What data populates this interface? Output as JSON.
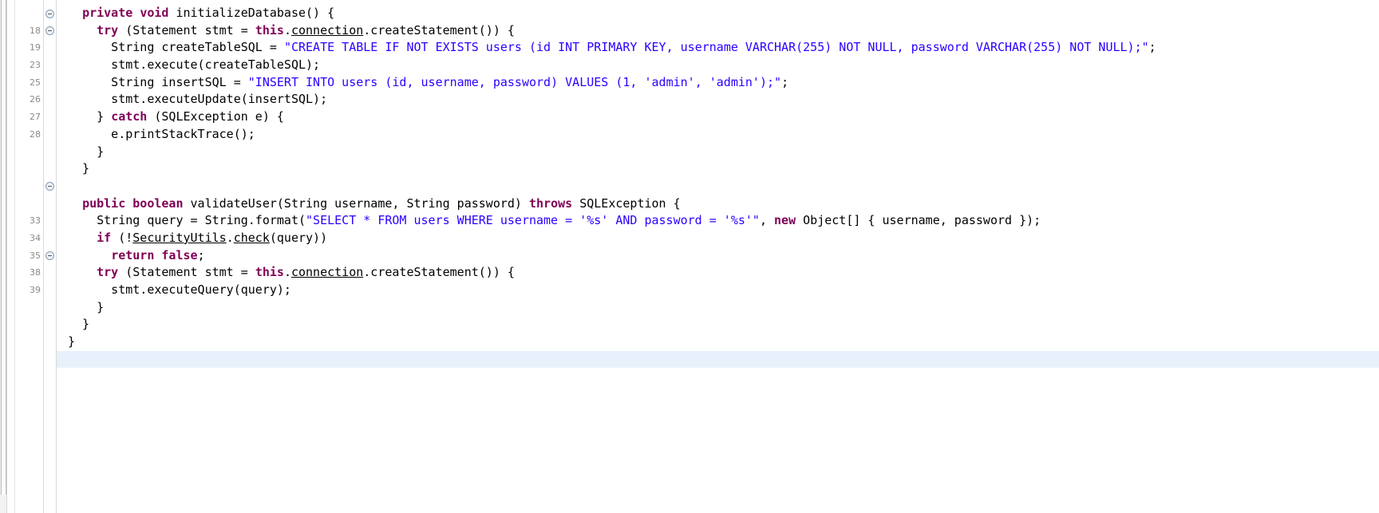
{
  "editor": {
    "language": "java",
    "colors": {
      "keyword": "#7f0055",
      "string": "#2a00ff",
      "field": "#0000c0",
      "text": "#000000",
      "gutter_text": "#8a8a8a",
      "current_line_highlight": "#e8f1fb",
      "background": "#ffffff"
    },
    "gutter": {
      "line_numbers": [
        "",
        "18",
        "19",
        "23",
        "25",
        "26",
        "27",
        "28",
        "",
        "",
        "",
        "33",
        "34",
        "35",
        "38",
        "39",
        "",
        "",
        "",
        "",
        ""
      ]
    },
    "fold_markers": [
      {
        "row": 0,
        "state": "collapsible"
      },
      {
        "row": 1,
        "state": "collapsible"
      },
      {
        "row": 10,
        "state": "collapsible"
      },
      {
        "row": 14,
        "state": "collapsible"
      }
    ],
    "lines": [
      {
        "index": 0,
        "number": "",
        "highlight": false,
        "tokens": [
          {
            "t": "  ",
            "k": "plain"
          },
          {
            "t": "private",
            "k": "kw"
          },
          {
            "t": " ",
            "k": "plain"
          },
          {
            "t": "void",
            "k": "kw"
          },
          {
            "t": " initializeDatabase() {",
            "k": "plain"
          }
        ]
      },
      {
        "index": 1,
        "number": "18",
        "highlight": false,
        "tokens": [
          {
            "t": "    ",
            "k": "plain"
          },
          {
            "t": "try",
            "k": "kw"
          },
          {
            "t": " (Statement stmt = ",
            "k": "plain"
          },
          {
            "t": "this",
            "k": "kw"
          },
          {
            "t": ".",
            "k": "plain"
          },
          {
            "t": "connection",
            "k": "stc"
          },
          {
            "t": ".createStatement()) {",
            "k": "plain"
          }
        ]
      },
      {
        "index": 2,
        "number": "19",
        "highlight": false,
        "tokens": [
          {
            "t": "      String createTableSQL = ",
            "k": "plain"
          },
          {
            "t": "\"CREATE TABLE IF NOT EXISTS users (id INT PRIMARY KEY, username VARCHAR(255) NOT NULL, password VARCHAR(255) NOT NULL);\"",
            "k": "str"
          },
          {
            "t": ";",
            "k": "plain"
          }
        ]
      },
      {
        "index": 3,
        "number": "23",
        "highlight": false,
        "tokens": [
          {
            "t": "      stmt.execute(createTableSQL);",
            "k": "plain"
          }
        ]
      },
      {
        "index": 4,
        "number": "25",
        "highlight": false,
        "tokens": [
          {
            "t": "      String insertSQL = ",
            "k": "plain"
          },
          {
            "t": "\"INSERT INTO users (id, username, password) VALUES (1, 'admin', 'admin');\"",
            "k": "str"
          },
          {
            "t": ";",
            "k": "plain"
          }
        ]
      },
      {
        "index": 5,
        "number": "26",
        "highlight": false,
        "tokens": [
          {
            "t": "      stmt.executeUpdate(insertSQL);",
            "k": "plain"
          }
        ]
      },
      {
        "index": 6,
        "number": "27",
        "highlight": false,
        "tokens": [
          {
            "t": "    } ",
            "k": "plain"
          },
          {
            "t": "catch",
            "k": "kw"
          },
          {
            "t": " (SQLException e) {",
            "k": "plain"
          }
        ]
      },
      {
        "index": 7,
        "number": "28",
        "highlight": false,
        "tokens": [
          {
            "t": "      e.printStackTrace();",
            "k": "plain"
          }
        ]
      },
      {
        "index": 8,
        "number": "",
        "highlight": false,
        "tokens": [
          {
            "t": "    }",
            "k": "plain"
          }
        ]
      },
      {
        "index": 9,
        "number": "",
        "highlight": false,
        "tokens": [
          {
            "t": "  }",
            "k": "plain"
          }
        ]
      },
      {
        "index": 10,
        "number": "",
        "highlight": false,
        "tokens": [
          {
            "t": "",
            "k": "plain"
          }
        ]
      },
      {
        "index": 11,
        "number": "",
        "highlight": false,
        "tokens": [
          {
            "t": "  ",
            "k": "plain"
          },
          {
            "t": "public",
            "k": "kw"
          },
          {
            "t": " ",
            "k": "plain"
          },
          {
            "t": "boolean",
            "k": "kw"
          },
          {
            "t": " validateUser(String username, String password) ",
            "k": "plain"
          },
          {
            "t": "throws",
            "k": "kw"
          },
          {
            "t": " SQLException {",
            "k": "plain"
          }
        ]
      },
      {
        "index": 12,
        "number": "33",
        "highlight": false,
        "tokens": [
          {
            "t": "    String query = String.format(",
            "k": "plain"
          },
          {
            "t": "\"SELECT * FROM users WHERE username = '%s' AND password = '%s'\"",
            "k": "str"
          },
          {
            "t": ", ",
            "k": "plain"
          },
          {
            "t": "new",
            "k": "kw"
          },
          {
            "t": " Object[] { username, password });",
            "k": "plain"
          }
        ]
      },
      {
        "index": 13,
        "number": "34",
        "highlight": false,
        "tokens": [
          {
            "t": "    ",
            "k": "plain"
          },
          {
            "t": "if",
            "k": "kw"
          },
          {
            "t": " (!",
            "k": "plain"
          },
          {
            "t": "SecurityUtils",
            "k": "stc"
          },
          {
            "t": ".",
            "k": "plain"
          },
          {
            "t": "check",
            "k": "stc"
          },
          {
            "t": "(query))",
            "k": "plain"
          }
        ]
      },
      {
        "index": 14,
        "number": "35",
        "highlight": false,
        "tokens": [
          {
            "t": "      ",
            "k": "plain"
          },
          {
            "t": "return",
            "k": "kw"
          },
          {
            "t": " ",
            "k": "plain"
          },
          {
            "t": "false",
            "k": "kw"
          },
          {
            "t": ";",
            "k": "plain"
          }
        ]
      },
      {
        "index": 15,
        "number": "38",
        "highlight": false,
        "tokens": [
          {
            "t": "    ",
            "k": "plain"
          },
          {
            "t": "try",
            "k": "kw"
          },
          {
            "t": " (Statement stmt = ",
            "k": "plain"
          },
          {
            "t": "this",
            "k": "kw"
          },
          {
            "t": ".",
            "k": "plain"
          },
          {
            "t": "connection",
            "k": "stc"
          },
          {
            "t": ".createStatement()) {",
            "k": "plain"
          }
        ]
      },
      {
        "index": 16,
        "number": "39",
        "highlight": false,
        "tokens": [
          {
            "t": "      stmt.executeQuery(query);",
            "k": "plain"
          }
        ]
      },
      {
        "index": 17,
        "number": "",
        "highlight": false,
        "tokens": [
          {
            "t": "    }",
            "k": "plain"
          }
        ]
      },
      {
        "index": 18,
        "number": "",
        "highlight": false,
        "tokens": [
          {
            "t": "  }",
            "k": "plain"
          }
        ]
      },
      {
        "index": 19,
        "number": "",
        "highlight": false,
        "tokens": [
          {
            "t": "}",
            "k": "plain"
          }
        ]
      },
      {
        "index": 20,
        "number": "",
        "highlight": true,
        "tokens": [
          {
            "t": "",
            "k": "plain"
          }
        ]
      }
    ]
  }
}
